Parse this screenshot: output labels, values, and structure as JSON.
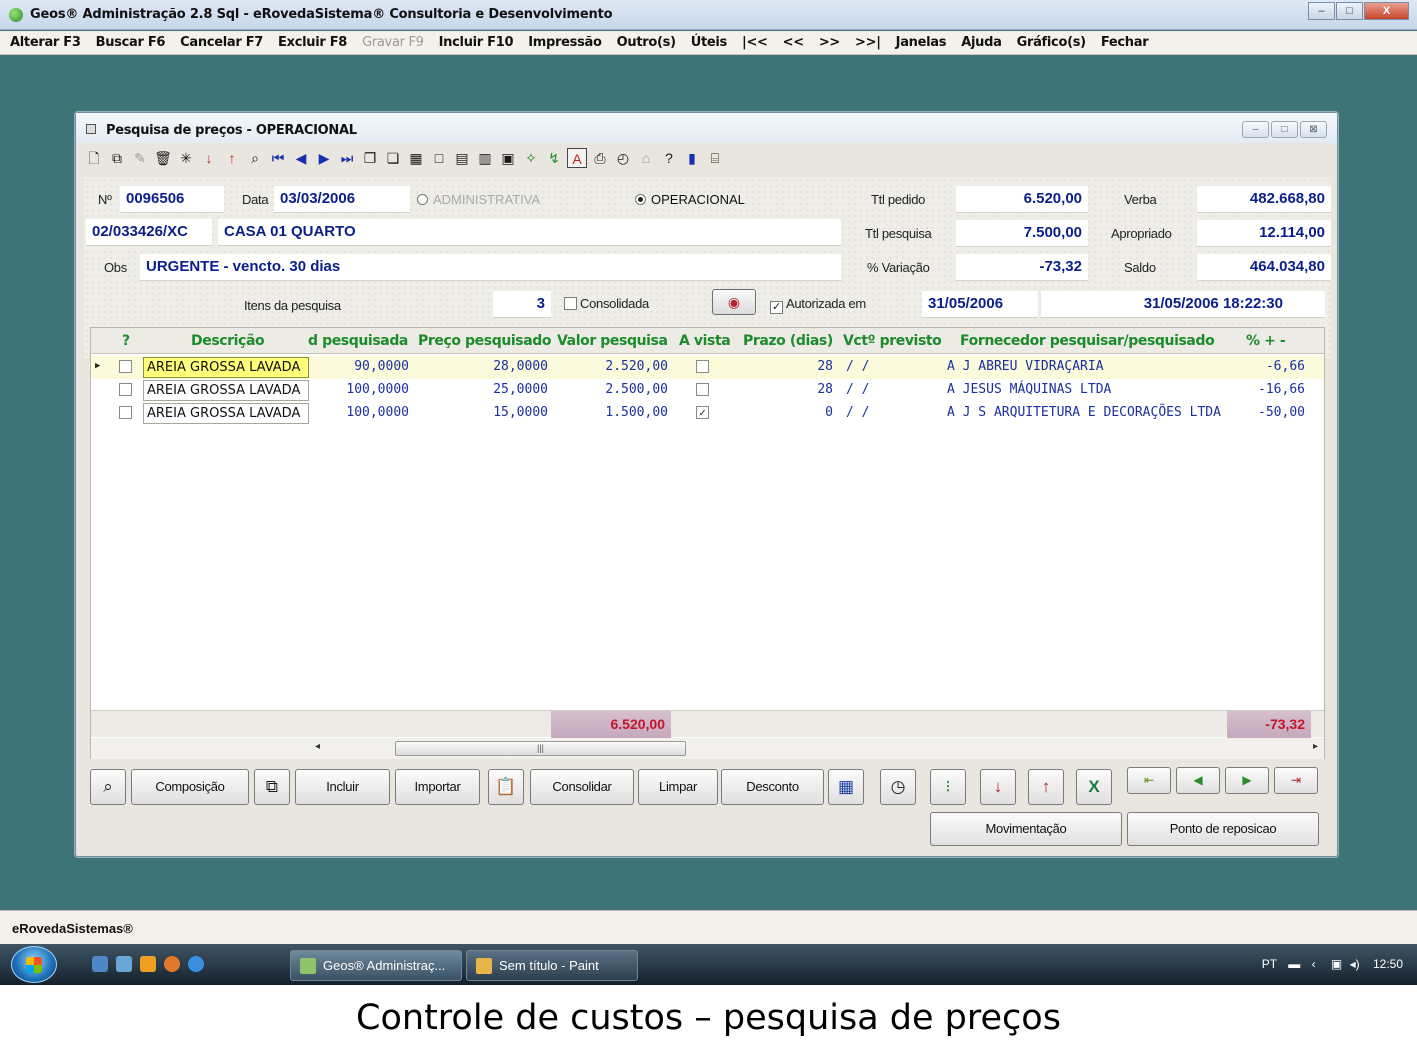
{
  "app": {
    "title": "Geos® Administração 2.8 Sql - eRovedaSistema® Consultoria e Desenvolvimento",
    "window_buttons": [
      "–",
      "□",
      "X"
    ]
  },
  "menu": [
    {
      "label": "Alterar F3",
      "enabled": true
    },
    {
      "label": "Buscar F6",
      "enabled": true
    },
    {
      "label": "Cancelar F7",
      "enabled": true
    },
    {
      "label": "Excluir F8",
      "enabled": true
    },
    {
      "label": "Gravar F9",
      "enabled": false
    },
    {
      "label": "Incluir F10",
      "enabled": true
    },
    {
      "label": "Impressão",
      "enabled": true
    },
    {
      "label": "Outro(s)",
      "enabled": true
    },
    {
      "label": "Úteis",
      "enabled": true
    },
    {
      "label": "|<<",
      "enabled": true
    },
    {
      "label": "<<",
      "enabled": true
    },
    {
      "label": ">>",
      "enabled": true
    },
    {
      "label": ">>|",
      "enabled": true
    },
    {
      "label": "Janelas",
      "enabled": true
    },
    {
      "label": "Ajuda",
      "enabled": true
    },
    {
      "label": "Gráfico(s)",
      "enabled": true
    },
    {
      "label": "Fechar",
      "enabled": true
    }
  ],
  "window": {
    "title": "Pesquisa de preços - OPERACIONAL",
    "buttons": [
      "–",
      "□",
      "⊠"
    ]
  },
  "form": {
    "numero_label": "Nº",
    "numero": "0096506",
    "data_label": "Data",
    "data": "03/03/2006",
    "radio_administrativa": "ADMINISTRATIVA",
    "radio_operacional": "OPERACIONAL",
    "codigo": "02/033426/XC",
    "descricao": "CASA 01 QUARTO",
    "obs_label": "Obs",
    "obs": "URGENTE - vencto. 30 dias",
    "itens_label": "Itens da pesquisa",
    "itens": "3",
    "consolidada_label": "Consolidada",
    "autorizada_label": "Autorizada em",
    "autorizada_data": "31/05/2006",
    "autorizada_datetime": "31/05/2006 18:22:30",
    "ttl_pedido_label": "Ttl pedido",
    "ttl_pedido": "6.520,00",
    "ttl_pesquisa_label": "Ttl pesquisa",
    "ttl_pesquisa": "7.500,00",
    "variacao_label": "% Variação",
    "variacao": "-73,32",
    "verba_label": "Verba",
    "verba": "482.668,80",
    "apropriado_label": "Apropriado",
    "apropriado": "12.114,00",
    "saldo_label": "Saldo",
    "saldo": "464.034,80"
  },
  "grid": {
    "headers": [
      "?",
      "Descrição",
      "d pesquisada",
      "Preço pesquisado",
      "Valor pesquisa",
      "A vista",
      "Prazo (dias)",
      "Vctº previsto",
      "Fornecedor pesquisar/pesquisado",
      "% + -"
    ],
    "rows": [
      {
        "descricao": "AREIA GROSSA LAVADA",
        "qtd": "90,0000",
        "preco": "28,0000",
        "valor": "2.520,00",
        "avista": false,
        "prazo": "28",
        "vct": "/ /",
        "fornecedor": "A J ABREU VIDRAÇARIA",
        "pct": "-6,66"
      },
      {
        "descricao": "AREIA GROSSA LAVADA",
        "qtd": "100,0000",
        "preco": "25,0000",
        "valor": "2.500,00",
        "avista": false,
        "prazo": "28",
        "vct": "/ /",
        "fornecedor": "A JESUS MÁQUINAS LTDA",
        "pct": "-16,66"
      },
      {
        "descricao": "AREIA GROSSA LAVADA",
        "qtd": "100,0000",
        "preco": "15,0000",
        "valor": "1.500,00",
        "avista": true,
        "prazo": "0",
        "vct": "/ /",
        "fornecedor": "A J S ARQUITETURA E DECORAÇÕES LTDA",
        "pct": "-50,00"
      }
    ],
    "total_valor": "6.520,00",
    "total_pct": "-73,32"
  },
  "buttons": {
    "composicao": "Composição",
    "incluir": "Incluir",
    "importar": "Importar",
    "consolidar": "Consolidar",
    "limpar": "Limpar",
    "desconto": "Desconto",
    "movimentacao": "Movimentação",
    "ponto_reposicao": "Ponto de reposicao"
  },
  "status_bar": "eRovedaSistemas®",
  "taskbar": {
    "tasks": [
      "Geos® Administraç...",
      "Sem título - Paint"
    ],
    "lang": "PT",
    "clock": "12:50"
  },
  "caption": "Controle de  custos – pesquisa de preços",
  "colors": {
    "desktop": "#3d7478",
    "header_text": "#1c8b2c",
    "value_text": "#0a1f8c",
    "total_text": "#c3142a"
  }
}
